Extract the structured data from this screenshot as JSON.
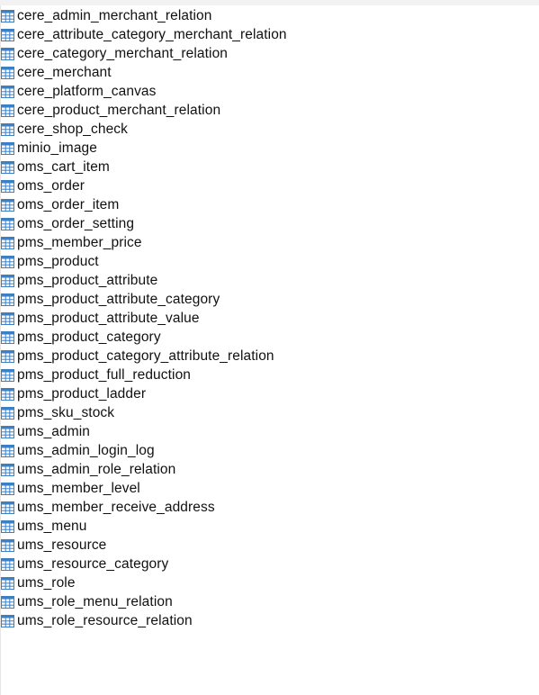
{
  "icon_color": "#3b7fc4",
  "icon_name": "table-grid-icon",
  "tables": [
    "cere_admin_merchant_relation",
    "cere_attribute_category_merchant_relation",
    "cere_category_merchant_relation",
    "cere_merchant",
    "cere_platform_canvas",
    "cere_product_merchant_relation",
    "cere_shop_check",
    "minio_image",
    "oms_cart_item",
    "oms_order",
    "oms_order_item",
    "oms_order_setting",
    "pms_member_price",
    "pms_product",
    "pms_product_attribute",
    "pms_product_attribute_category",
    "pms_product_attribute_value",
    "pms_product_category",
    "pms_product_category_attribute_relation",
    "pms_product_full_reduction",
    "pms_product_ladder",
    "pms_sku_stock",
    "ums_admin",
    "ums_admin_login_log",
    "ums_admin_role_relation",
    "ums_member_level",
    "ums_member_receive_address",
    "ums_menu",
    "ums_resource",
    "ums_resource_category",
    "ums_role",
    "ums_role_menu_relation",
    "ums_role_resource_relation"
  ]
}
